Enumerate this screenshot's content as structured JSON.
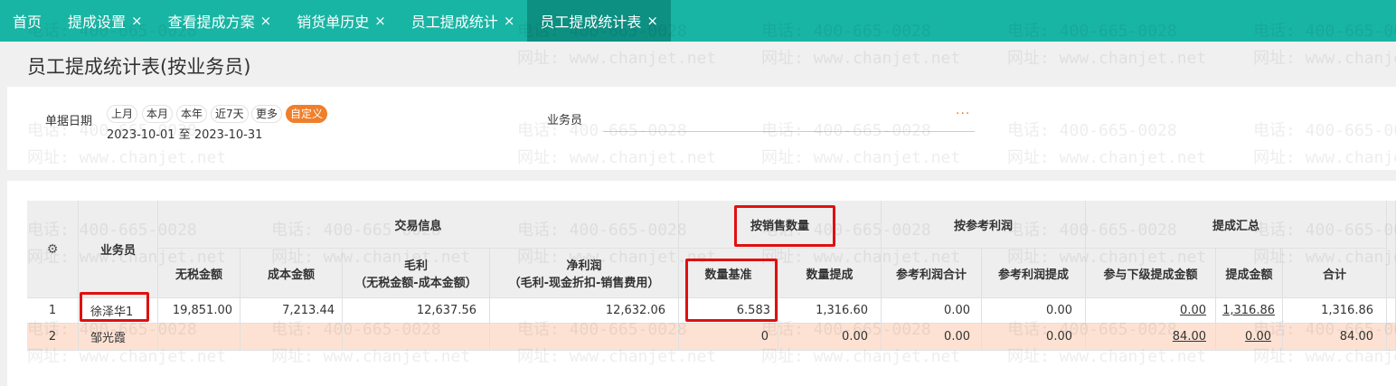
{
  "tabs": [
    {
      "label": "首页",
      "closable": false,
      "active": false
    },
    {
      "label": "提成设置",
      "closable": true,
      "active": false
    },
    {
      "label": "查看提成方案",
      "closable": true,
      "active": false
    },
    {
      "label": "销货单历史",
      "closable": true,
      "active": false
    },
    {
      "label": "员工提成统计",
      "closable": true,
      "active": false
    },
    {
      "label": "员工提成统计表",
      "closable": true,
      "active": true
    }
  ],
  "close_glyph": "×",
  "page_title": "员工提成统计表(按业务员)",
  "filter": {
    "date_label": "单据日期",
    "date_options": [
      "上月",
      "本月",
      "本年",
      "近7天",
      "更多",
      "自定义"
    ],
    "date_range": "2023-10-01 至 2023-10-31",
    "salesperson_label": "业务员",
    "more_button": "···"
  },
  "table": {
    "group_headers": {
      "transaction": "交易信息",
      "by_sales_qty": "按销售数量",
      "by_ref_profit": "按参考利润",
      "summary": "提成汇总"
    },
    "headers": {
      "salesperson": "业务员",
      "untaxed_amount": "无税金额",
      "cost_amount": "成本金额",
      "gross_profit_1": "毛利",
      "gross_profit_2": "（无税金额-成本金额）",
      "net_profit_1": "净利润",
      "net_profit_2": "（毛利-现金折扣-销售费用）",
      "qty_base": "数量基准",
      "qty_commission": "数量提成",
      "ref_profit_total": "参考利润合计",
      "ref_profit_commission": "参考利润提成",
      "sub_commission": "参与下级提成金额",
      "commission_amount": "提成金额",
      "total": "合计"
    },
    "rows": [
      {
        "index": "1",
        "salesperson": "徐泽华1",
        "untaxed_amount": "19,851.00",
        "cost_amount": "7,213.44",
        "gross_profit": "12,637.56",
        "net_profit": "12,632.06",
        "qty_base": "6.583",
        "qty_commission": "1,316.60",
        "ref_profit_total": "0.00",
        "ref_profit_commission": "0.00",
        "sub_commission": "0.00",
        "commission_amount": "1,316.86",
        "total": "1,316.86"
      },
      {
        "index": "2",
        "salesperson": "邹光霞",
        "untaxed_amount": "",
        "cost_amount": "",
        "gross_profit": "",
        "net_profit": "",
        "qty_base": "0",
        "qty_commission": "0.00",
        "ref_profit_total": "0.00",
        "ref_profit_commission": "0.00",
        "sub_commission": "84.00",
        "commission_amount": "0.00",
        "total": "84.00"
      }
    ]
  },
  "watermark": {
    "phone": "电话: 400-665-0028",
    "site": "网址: www.chanjet.net"
  },
  "colors": {
    "tab_bar": "#19b5a4",
    "tab_active": "#0d8f82",
    "accent_orange": "#f07f2b",
    "highlight_row": "#fde2d3",
    "annotation_red": "#e01010"
  }
}
